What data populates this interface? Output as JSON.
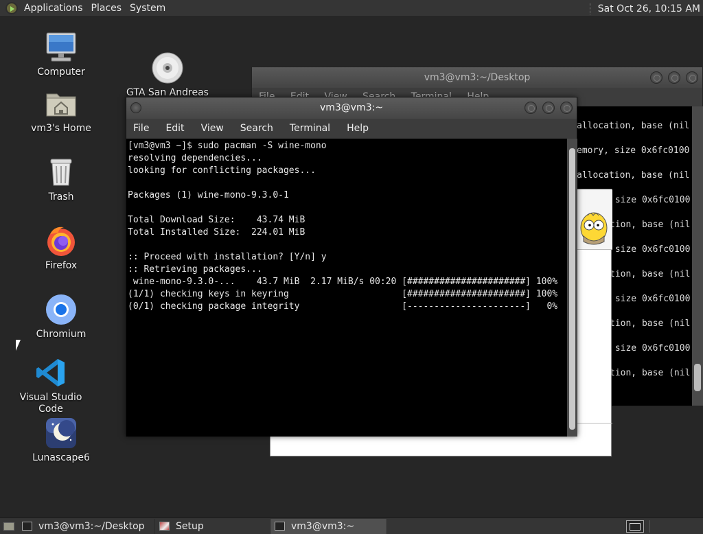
{
  "top_panel": {
    "menus": [
      "Applications",
      "Places",
      "System"
    ],
    "clock": "Sat Oct 26, 10:15 AM"
  },
  "desktop_icons": [
    {
      "label": "Computer",
      "icon": "computer-icon"
    },
    {
      "label": "vm3's Home",
      "icon": "home-folder-icon"
    },
    {
      "label": "Trash",
      "icon": "trash-icon"
    },
    {
      "label": "Firefox",
      "icon": "firefox-icon"
    },
    {
      "label": "Chromium",
      "icon": "chromium-icon"
    },
    {
      "label": "Visual Studio Code",
      "icon": "vscode-icon"
    },
    {
      "label": "Lunascape6",
      "icon": "lunascape-icon"
    },
    {
      "label": "GTA San Andreas\nOptiProjects.iso",
      "icon": "disc-icon"
    }
  ],
  "back_terminal": {
    "title": "vm3@vm3:~/Desktop",
    "menu": [
      "File",
      "Edit",
      "View",
      "Search",
      "Terminal",
      "Help"
    ],
    "lines": [
      "allocation, base (nil",
      "emory, size 0x6fc0100",
      "allocation, base (nil",
      " size 0x6fc0100",
      "tion, base (nil",
      " size 0x6fc0100",
      "tion, base (nil",
      " size 0x6fc0100",
      "tion, base (nil",
      " size 0x6fc0100",
      "tion, base (nil"
    ]
  },
  "front_terminal": {
    "title": "vm3@vm3:~",
    "menu": [
      "File",
      "Edit",
      "View",
      "Search",
      "Terminal",
      "Help"
    ],
    "lines": [
      "[vm3@vm3 ~]$ sudo pacman -S wine-mono",
      "resolving dependencies...",
      "looking for conflicting packages...",
      "",
      "Packages (1) wine-mono-9.3.0-1",
      "",
      "Total Download Size:    43.74 MiB",
      "Total Installed Size:  224.01 MiB",
      "",
      ":: Proceed with installation? [Y/n] y",
      ":: Retrieving packages...",
      " wine-mono-9.3.0-...    43.7 MiB  2.17 MiB/s 00:20 [######################] 100%",
      "(1/1) checking keys in keyring                     [######################] 100%",
      "(0/1) checking package integrity                   [----------------------]   0%"
    ]
  },
  "taskbar": {
    "tasks": [
      {
        "label": "vm3@vm3:~/Desktop",
        "active": false
      },
      {
        "label": "Setup",
        "active": false
      },
      {
        "label": "vm3@vm3:~",
        "active": true
      }
    ]
  }
}
